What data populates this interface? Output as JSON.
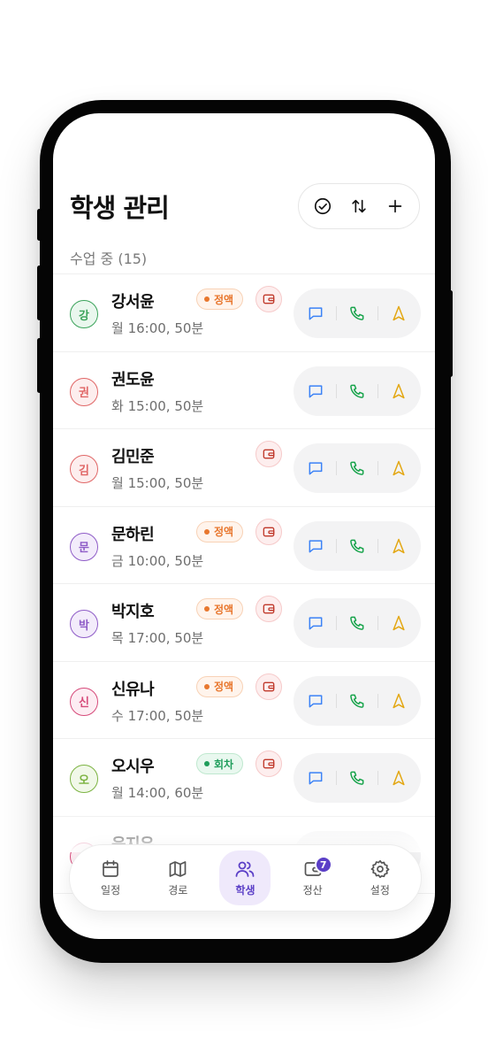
{
  "header": {
    "title": "학생 관리"
  },
  "toolbar": {
    "icons": [
      "check-circle-icon",
      "sort-icon",
      "plus-icon"
    ]
  },
  "section": {
    "label": "수업 중 (15)"
  },
  "colors": {
    "accent": "#5b3fc7",
    "message": "#3b82f6",
    "phone": "#16a34a",
    "navigate": "#eab308",
    "wallet": "#c0392b"
  },
  "students": [
    {
      "initial": "강",
      "name": "강서윤",
      "schedule": "월 16:00, 50분",
      "badge": "정액",
      "badge_type": "fixed",
      "wallet": true,
      "avatar_color": "#3aa35a",
      "avatar_bg": "#eaf7ee"
    },
    {
      "initial": "권",
      "name": "권도윤",
      "schedule": "화 15:00, 50분",
      "badge": "",
      "badge_type": "",
      "wallet": false,
      "avatar_color": "#e06666",
      "avatar_bg": "#fdeeee"
    },
    {
      "initial": "김",
      "name": "김민준",
      "schedule": "월 15:00, 50분",
      "badge": "",
      "badge_type": "",
      "wallet": true,
      "avatar_color": "#e06666",
      "avatar_bg": "#fdeeee"
    },
    {
      "initial": "문",
      "name": "문하린",
      "schedule": "금 10:00, 50분",
      "badge": "정액",
      "badge_type": "fixed",
      "wallet": true,
      "avatar_color": "#8e5bc7",
      "avatar_bg": "#f3ecfb"
    },
    {
      "initial": "박",
      "name": "박지호",
      "schedule": "목 17:00, 50분",
      "badge": "정액",
      "badge_type": "fixed",
      "wallet": true,
      "avatar_color": "#8e5bc7",
      "avatar_bg": "#f3ecfb"
    },
    {
      "initial": "신",
      "name": "신유나",
      "schedule": "수 17:00, 50분",
      "badge": "정액",
      "badge_type": "fixed",
      "wallet": true,
      "avatar_color": "#d64a7a",
      "avatar_bg": "#fdedf3"
    },
    {
      "initial": "오",
      "name": "오시우",
      "schedule": "월 14:00, 60분",
      "badge": "회차",
      "badge_type": "session",
      "wallet": true,
      "avatar_color": "#7cb342",
      "avatar_bg": "#f1f8e9"
    },
    {
      "initial": "",
      "name": "윤지우",
      "schedule": "",
      "badge": "",
      "badge_type": "",
      "wallet": false,
      "avatar_color": "#d64a7a",
      "avatar_bg": "#fdedf3"
    }
  ],
  "nav": {
    "items": [
      {
        "label": "일정",
        "icon": "calendar-icon",
        "active": false
      },
      {
        "label": "경로",
        "icon": "map-icon",
        "active": false
      },
      {
        "label": "학생",
        "icon": "users-icon",
        "active": true
      },
      {
        "label": "정산",
        "icon": "wallet-icon",
        "active": false,
        "badge": "7"
      },
      {
        "label": "설정",
        "icon": "gear-icon",
        "active": false
      }
    ]
  }
}
